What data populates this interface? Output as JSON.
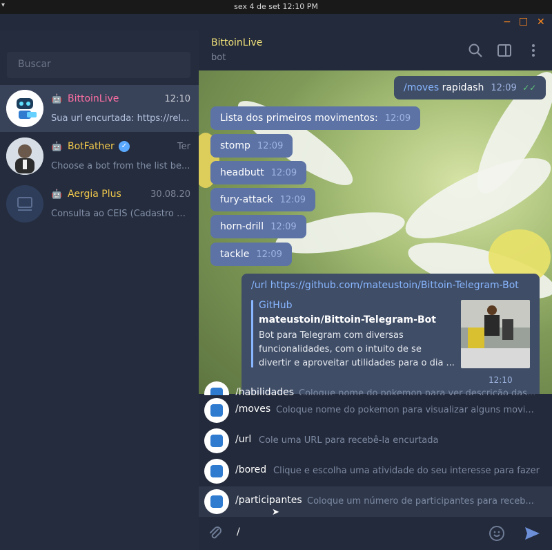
{
  "system_bar": {
    "clock": "sex 4 de set   12:10 PM"
  },
  "window_controls": {
    "minimize": "−",
    "maximize": "□",
    "close": "✕",
    "accent": "#ff8a1f"
  },
  "sidebar": {
    "search_placeholder": "Buscar",
    "chats": [
      {
        "name": "BittoinLive",
        "time": "12:10",
        "preview": "Sua url encurtada: https://rel...",
        "icon": "bot-icon",
        "active": true
      },
      {
        "name": "BotFather",
        "time": "Ter",
        "preview": "Choose a bot from the list be...",
        "icon": "bot-icon",
        "verified": true
      },
      {
        "name": "Aergia Plus",
        "time": "30.08.20",
        "preview": "Consulta ao CEIS (Cadastro N...",
        "icon": "bot-icon"
      }
    ]
  },
  "chat_header": {
    "title": "BittoinLive",
    "subtitle": "bot",
    "icons": [
      "search-icon",
      "sidebar-toggle-icon",
      "more-vert-icon"
    ]
  },
  "messages": [
    {
      "dir": "out",
      "cmd": "/moves",
      "text": " rapidash",
      "time": "12:09"
    },
    {
      "dir": "in",
      "text": "Lista dos primeiros movimentos:",
      "time": "12:09"
    },
    {
      "dir": "in",
      "text": "stomp",
      "time": "12:09"
    },
    {
      "dir": "in",
      "text": "headbutt",
      "time": "12:09"
    },
    {
      "dir": "in",
      "text": "fury-attack",
      "time": "12:09"
    },
    {
      "dir": "in",
      "text": "horn-drill",
      "time": "12:09"
    },
    {
      "dir": "in",
      "text": "tackle",
      "time": "12:09"
    }
  ],
  "link_message": {
    "cmd": "/url",
    "url": "https://github.com/mateustoin/Bittoin-Telegram-Bot",
    "preview_site": "GitHub",
    "preview_title": "mateustoin/Bittoin-Telegram-Bot",
    "preview_lines": [
      "Bot para Telegram com diversas",
      "funcionalidades, com o intuito de se",
      "divertir e aproveitar utilidades para o dia ..."
    ],
    "time": "12:10"
  },
  "commands": [
    {
      "name": "/habilidades",
      "desc": "Coloque nome do pokemon para ver descrição das..."
    },
    {
      "name": "/moves",
      "desc": "Coloque nome do pokemon para visualizar alguns movi..."
    },
    {
      "name": "/url",
      "desc": "Cole uma URL para recebê-la encurtada"
    },
    {
      "name": "/bored",
      "desc": "Clique e escolha uma atividade do seu interesse para fazer"
    },
    {
      "name": "/participantes",
      "desc": "Coloque um número de participantes para receb..."
    }
  ],
  "composer": {
    "text": "/",
    "icons": [
      "attach-icon",
      "emoji-icon",
      "send-icon"
    ]
  }
}
